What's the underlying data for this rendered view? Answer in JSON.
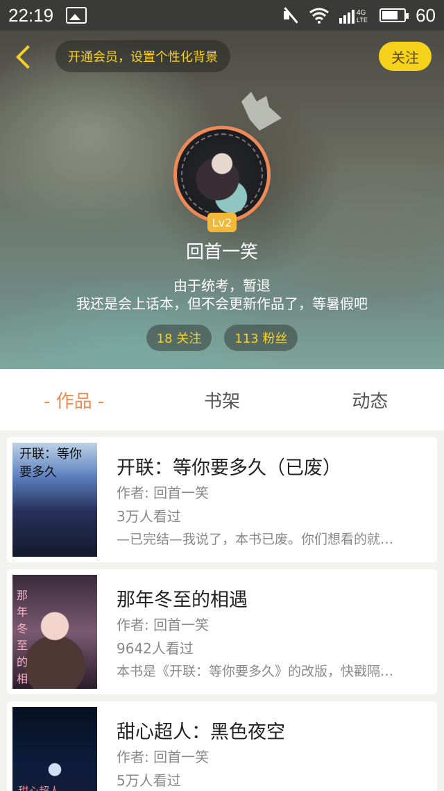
{
  "status_bar": {
    "time": "22:19",
    "network": "4G",
    "battery": "60"
  },
  "header": {
    "vip_banner": "开通会员，设置个性化背景",
    "follow_label": "关注",
    "level": "Lv2",
    "username": "回首一笑",
    "bio_line1": "由于统考，暂退",
    "bio_line2": "我还是会上话本，但不会更新作品了，等暑假吧",
    "following": "18 关注",
    "followers": "113 粉丝",
    "accent_color": "#f7d02a"
  },
  "tabs": [
    {
      "label": "- 作品 -",
      "active": true
    },
    {
      "label": "书架",
      "active": false
    },
    {
      "label": "动态",
      "active": false
    }
  ],
  "books": [
    {
      "title": "开联：等你要多久（已废）",
      "author": "作者: 回首一笑",
      "views": "3万人看过",
      "description": "—已完结—我说了，本书已废。你们想看的就…",
      "cover_text": "开联：等你\n要多久"
    },
    {
      "title": "那年冬至的相遇",
      "author": "作者: 回首一笑",
      "views": "9642人看过",
      "description": "本书是《开联：等你要多久》的改版，快戳隔…",
      "cover_text": "那年冬至的相遇"
    },
    {
      "title": "甜心超人：黑色夜空",
      "author": "作者: 回首一笑",
      "views": "5万人看过",
      "description": "",
      "cover_text": "甜心超人"
    }
  ]
}
